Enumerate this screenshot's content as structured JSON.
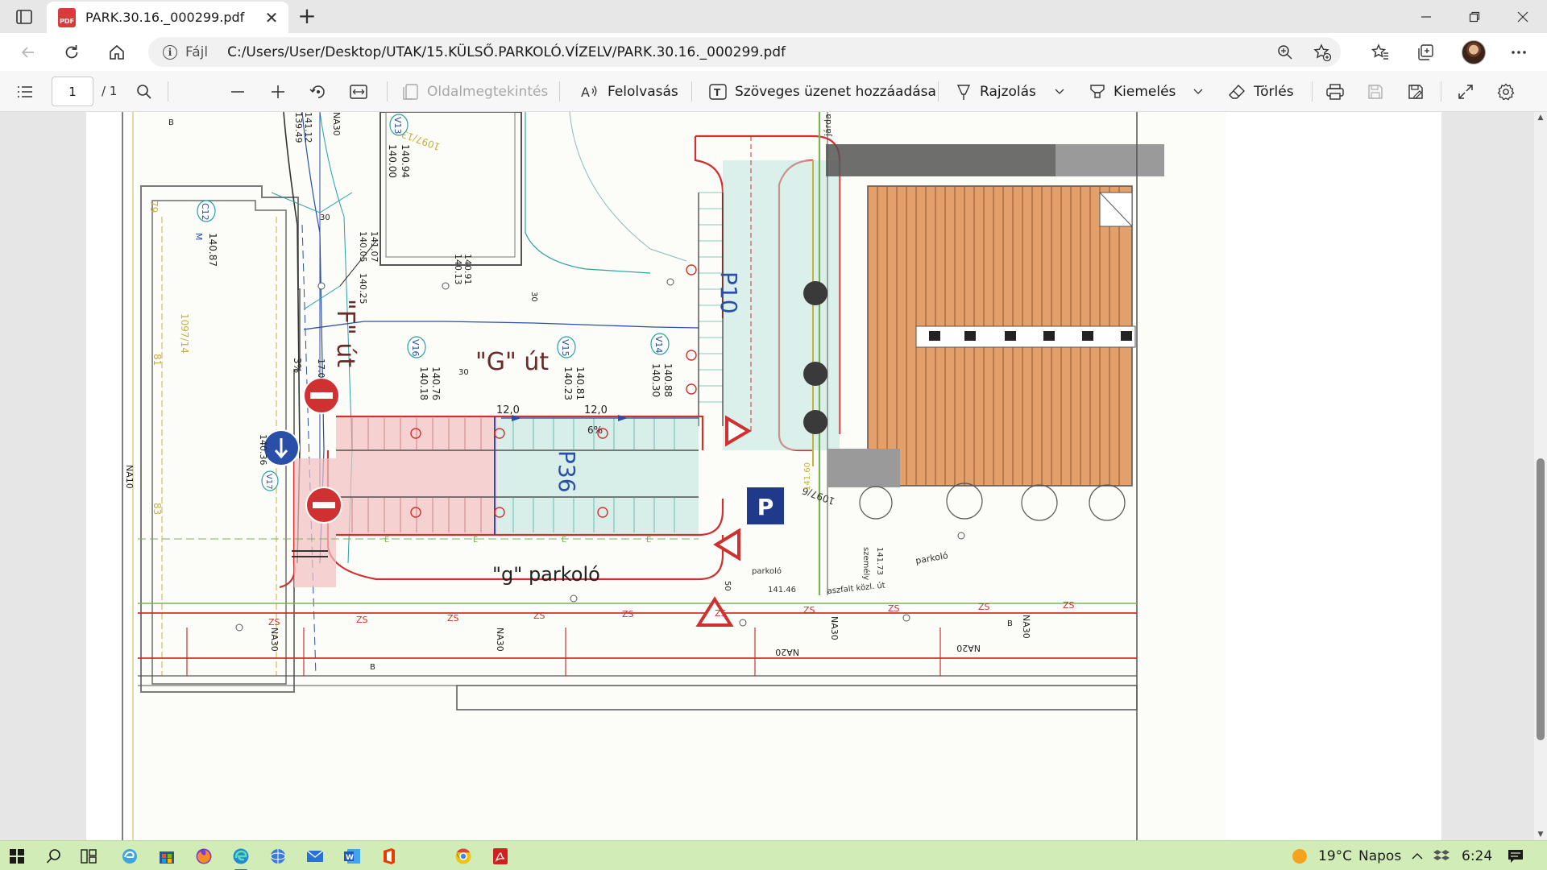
{
  "browser": {
    "tab": {
      "title": "PARK.30.16._000299.pdf",
      "icon": "pdf-file-icon"
    },
    "address": {
      "scheme": "Fájl",
      "url": "C:/Users/User/Desktop/UTAK/15.KÜLSŐ.PARKOLÓ.VÍZELV/PARK.30.16._000299.pdf"
    }
  },
  "toolbar": {
    "page_current": "1",
    "page_total": "/ 1",
    "page_view": "Oldalmegtekintés",
    "read_aloud": "Felolvasás",
    "add_text": "Szöveges üzenet hozzáadása",
    "draw": "Rajzolás",
    "highlight": "Kiemelés",
    "erase": "Törlés"
  },
  "drawing": {
    "f_road": "\"F\" út",
    "g_road": "\"G\" út",
    "g_parking": "\"g\" parkoló",
    "p10": "P10",
    "p36": "P36",
    "parking_sign": "P",
    "lot_1097_13": "1097/13",
    "lot_1097_14": "1097/14",
    "lot_1097_6": "1097/6",
    "lot_79": "79",
    "lot_81": "81",
    "lot_83": "83",
    "dim_12_a": "12,0",
    "dim_12_b": "12,0",
    "slope_6": "6%",
    "slope_3": "3%",
    "v13": "V13",
    "v14": "V14",
    "v15": "V15",
    "v16": "V16",
    "v17": "V17",
    "c12": "C12",
    "c12_m": "M",
    "elev_140_87": "140.87",
    "elev_140_94": "140.94",
    "elev_140_00": "140.00",
    "elev_141_07": "141.07",
    "elev_140_05": "140.05",
    "elev_140_25": "140.25",
    "elev_140_91": "140.91",
    "elev_140_13": "140.13",
    "elev_140_76": "140.76",
    "elev_140_18": "140.18",
    "elev_140_81": "140.81",
    "elev_140_23": "140.23",
    "elev_140_88": "140.88",
    "elev_140_30": "140.30",
    "elev_139_49": "139.49",
    "elev_141_12": "141.12",
    "elev_17": "17.0",
    "elev_140_36": "140.36",
    "na30": "NA30",
    "na20": "NA20",
    "na10": "NA10",
    "zs": "ZS",
    "e": "E",
    "b": "B",
    "jarda": "járda",
    "parkolo": "parkoló",
    "aszfalt": "aszfalt közl. út",
    "szemely": "személy",
    "elev_141_73": "141.73",
    "elev_141_60": "141.60",
    "elev_141_46": "141.46",
    "thirty": "30",
    "fifty": "50"
  },
  "taskbar": {
    "weather_temp": "19°C",
    "weather_text": "Napos",
    "time": "6:24"
  },
  "colors": {
    "red_road": "#d03030",
    "blue_line": "#2a4fa8",
    "teal_line": "#2aa0a0",
    "roof_orange": "#e4a06a",
    "taskbar_green": "#d2ecb8"
  }
}
